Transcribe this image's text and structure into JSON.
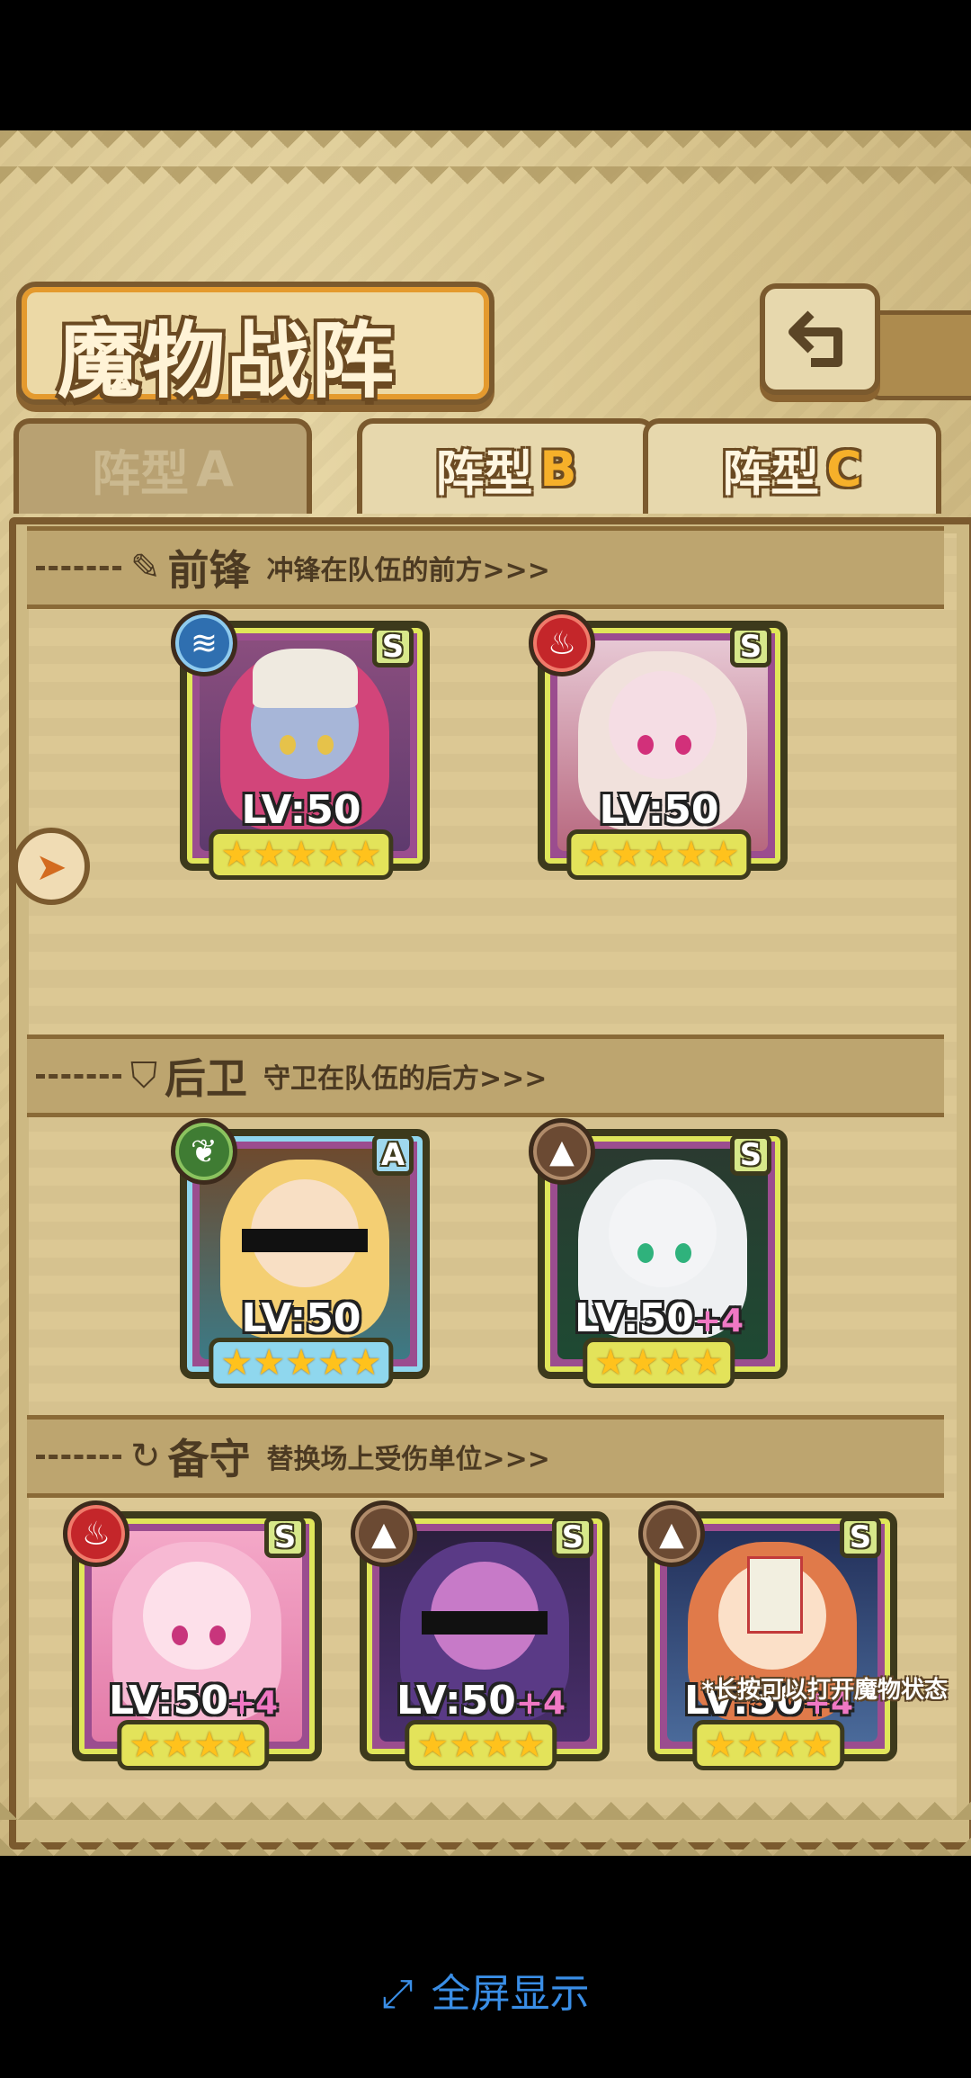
{
  "title": "魔物战阵",
  "tabs": [
    {
      "prefix": "阵型",
      "suffix": "A",
      "active": false
    },
    {
      "prefix": "阵型",
      "suffix": "B",
      "active": true
    },
    {
      "prefix": "阵型",
      "suffix": "C",
      "active": true
    }
  ],
  "sections": {
    "front": {
      "title": "前锋",
      "subtitle": "冲锋在队伍的前方>>>",
      "icon": "sword-icon"
    },
    "rear": {
      "title": "后卫",
      "subtitle": "守卫在队伍的后方>>>",
      "icon": "shield-icon"
    },
    "reserve": {
      "title": "备守",
      "subtitle": "替换场上受伤单位>>>",
      "icon": "swap-icon"
    }
  },
  "cards": {
    "front1": {
      "element": "water",
      "grade": "S",
      "level": "LV:50",
      "plus": "",
      "stars": "★★★★★"
    },
    "front2": {
      "element": "fire",
      "grade": "S",
      "level": "LV:50",
      "plus": "",
      "stars": "★★★★★"
    },
    "rear1": {
      "element": "nature",
      "grade": "A",
      "level": "LV:50",
      "plus": "",
      "stars": "★★★★★"
    },
    "rear2": {
      "element": "earth",
      "grade": "S",
      "level": "LV:50",
      "plus": "+4",
      "stars": "★★★★"
    },
    "res1": {
      "element": "fire",
      "grade": "S",
      "level": "LV:50",
      "plus": "+4",
      "stars": "★★★★"
    },
    "res2": {
      "element": "earth",
      "grade": "S",
      "level": "LV:50",
      "plus": "+4",
      "stars": "★★★★"
    },
    "res3": {
      "element": "earth",
      "grade": "S",
      "level": "LV:50",
      "plus": "+4",
      "stars": "★★★★"
    }
  },
  "hint": "*长按可以打开魔物状态",
  "fullscreen_label": "全屏显示",
  "colors": {
    "accent": "#e49a2e",
    "frame": "#7b5a2e",
    "link": "#3a8ee6"
  }
}
